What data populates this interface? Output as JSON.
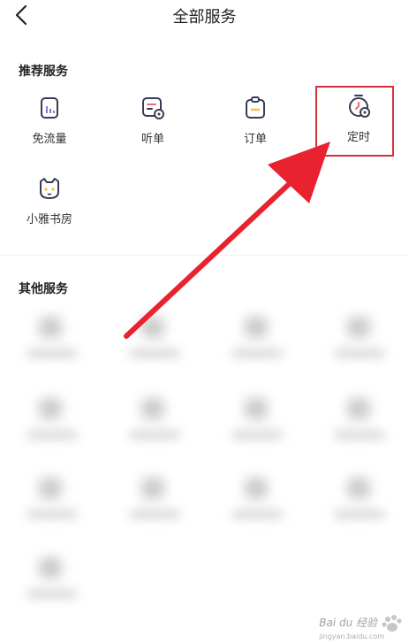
{
  "header": {
    "title": "全部服务"
  },
  "recommended": {
    "title": "推荐服务",
    "items": [
      {
        "label": "免流量",
        "icon": "data-free-icon"
      },
      {
        "label": "听单",
        "icon": "listen-list-icon"
      },
      {
        "label": "订单",
        "icon": "order-clipboard-icon"
      },
      {
        "label": "定时",
        "icon": "timer-icon"
      },
      {
        "label": "小雅书房",
        "icon": "cat-face-icon"
      }
    ]
  },
  "other": {
    "title": "其他服务"
  },
  "watermark": {
    "text": "Bai du 经验",
    "sub": "jingyan.baidu.com"
  },
  "colors": {
    "accent": "#d6303a",
    "icon_dark": "#3a3a55",
    "icon_red": "#f06a72",
    "icon_yellow": "#f3c23c"
  }
}
